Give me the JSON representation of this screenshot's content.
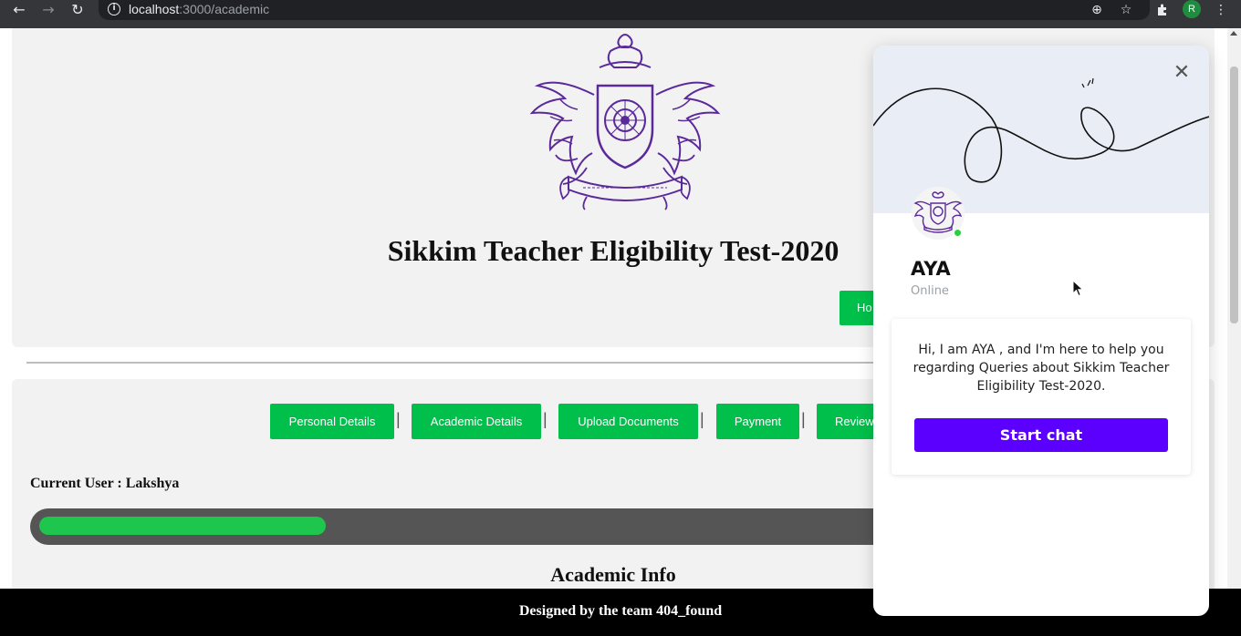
{
  "browser": {
    "url_host": "localhost",
    "url_rest": ":3000/academic",
    "profile_initial": "R",
    "icons": [
      "back-icon",
      "forward-icon",
      "reload-icon",
      "info-icon",
      "zoom-icon",
      "star-icon",
      "extensions-icon",
      "menu-icon"
    ]
  },
  "header": {
    "title": "Sikkim Teacher Eligibility Test-2020",
    "home_label": "Ho"
  },
  "steps": {
    "items": [
      {
        "label": "Personal Details"
      },
      {
        "label": "Academic Details"
      },
      {
        "label": "Upload Documents"
      },
      {
        "label": "Payment"
      },
      {
        "label": "Review"
      }
    ],
    "separator": "|"
  },
  "main": {
    "current_user": "Current User : Lakshya",
    "progress": 0.32,
    "section_title": "Academic Info"
  },
  "footer": {
    "text": "Designed by the team 404_found"
  },
  "chat": {
    "name": "AYA",
    "status": "Online",
    "message": "Hi, I am AYA , and I'm here to help you regarding Queries about Sikkim Teacher Eligibility Test-2020.",
    "start_label": "Start chat"
  },
  "colors": {
    "accent_green": "#00c04b",
    "chat_purple": "#5b00ff",
    "emblem_purple": "#5b2a9a"
  }
}
